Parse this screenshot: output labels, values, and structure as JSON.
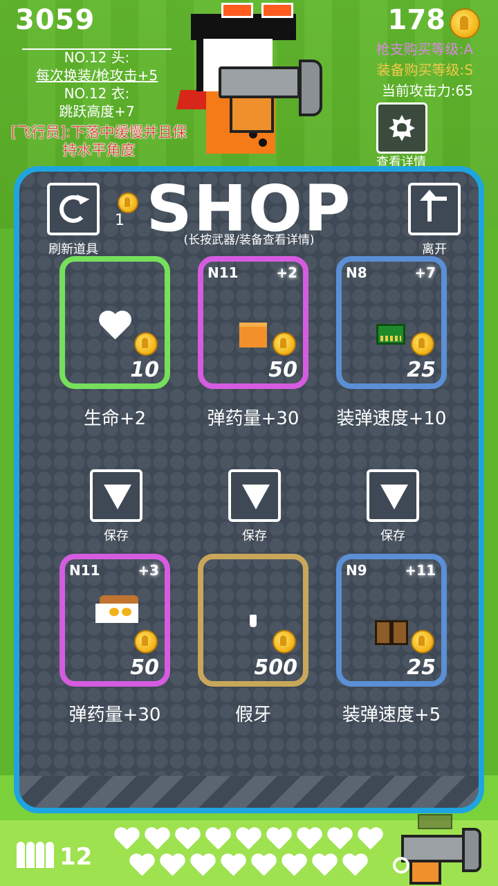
{
  "hud": {
    "score": "3059",
    "coins": "178",
    "equipment": [
      {
        "text": "NO.12 头:",
        "underline": false
      },
      {
        "text": "每次换装/枪攻击+5",
        "underline": true
      },
      {
        "text": "NO.12 衣:",
        "underline": false
      },
      {
        "text": "跳跃高度+7",
        "underline": false
      }
    ],
    "flyer_note": "[飞行员]:下落中缓慢并且保持水平角度",
    "gun_grade": "枪支购买等级:A",
    "gear_grade": "装备购买等级:S",
    "attack": "当前攻击力:65",
    "detail_label": "查看详情",
    "ammo": "12",
    "hearts_top_row": 9,
    "hearts_bottom_row": 8
  },
  "shop": {
    "title": "SHOP",
    "subtitle": "(长按武器/装备查看详情)",
    "refresh_label": "刷新道具",
    "refresh_cost": "1",
    "leave_label": "离开",
    "save_label": "保存",
    "row1": [
      {
        "name": "生命+2",
        "price": "10",
        "level": "",
        "plus": "",
        "frame": "green",
        "icon": "heart-icon"
      },
      {
        "name": "弹药量+30",
        "price": "50",
        "level": "N11",
        "plus": "+2",
        "frame": "purple",
        "icon": "ammo-box-icon"
      },
      {
        "name": "装弹速度+10",
        "price": "25",
        "level": "N8",
        "plus": "+7",
        "frame": "blue",
        "icon": "magazine-icon"
      }
    ],
    "row2": [
      {
        "name": "弹药量+30",
        "price": "50",
        "level": "N11",
        "plus": "+3",
        "frame": "purple",
        "icon": "hat-icon"
      },
      {
        "name": "假牙",
        "price": "500",
        "level": "",
        "plus": "",
        "frame": "tan",
        "icon": "tooth-icon"
      },
      {
        "name": "装弹速度+5",
        "price": "25",
        "level": "N9",
        "plus": "+11",
        "frame": "blue",
        "icon": "crate-icon"
      }
    ]
  },
  "colors": {
    "frame_green": "#76e05c",
    "frame_purple": "#d55ce0",
    "frame_blue": "#5b8fd6",
    "frame_tan": "#c9a75a",
    "panel_border": "#1ea5e0",
    "gun_grade": "#d98ae0",
    "gear_grade": "#f2c94c",
    "note_red": "#d22a1b"
  }
}
